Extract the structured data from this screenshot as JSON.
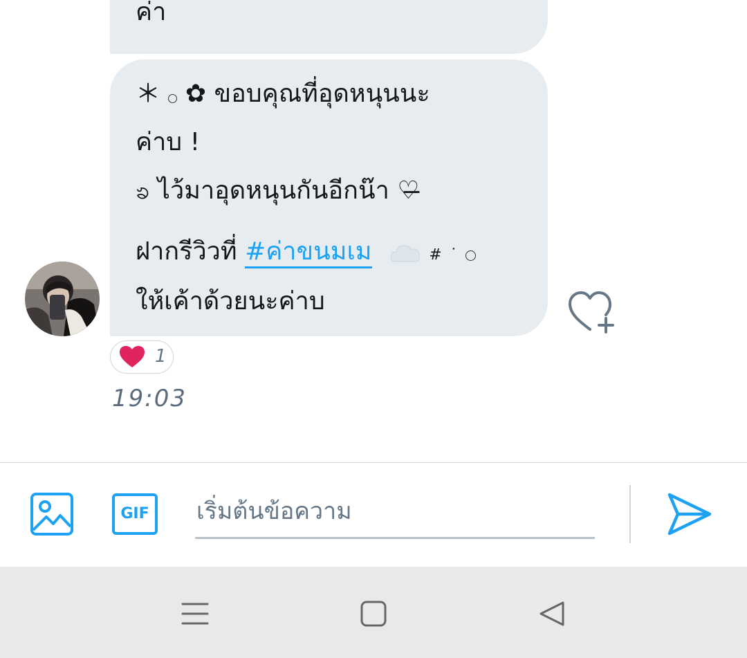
{
  "conversation": {
    "previous_message_tail": "ค่า",
    "message": {
      "line1_prefix": "＊",
      "line1_flower": "✿",
      "line1_text": "ขอบคุณที่อุดหนุนนะ",
      "line2": "ค่าบ !",
      "line3_ribbon": "ၶ",
      "line3_text": "ไว้มาอุดหนุนกันอีกน๊า",
      "line3_heart": "♡̶",
      "line4_text": "ฝากรีวิวที่",
      "line4_hashtag": "#ค่าขนมเม",
      "line4_hash": "#",
      "line4_dot": "˙",
      "line5": "ให้เค้าด้วยนะค่าบ"
    },
    "reaction": {
      "emoji": "heart-emoji",
      "count": "1"
    },
    "timestamp": "19:03"
  },
  "composer": {
    "placeholder": "เริ่มต้นข้อความ",
    "gif_label": "GIF"
  },
  "colors": {
    "accent": "#1da1f2",
    "bubble": "#e6ecf0",
    "heart": "#e0245e",
    "navbar": "#e9e9e9"
  }
}
